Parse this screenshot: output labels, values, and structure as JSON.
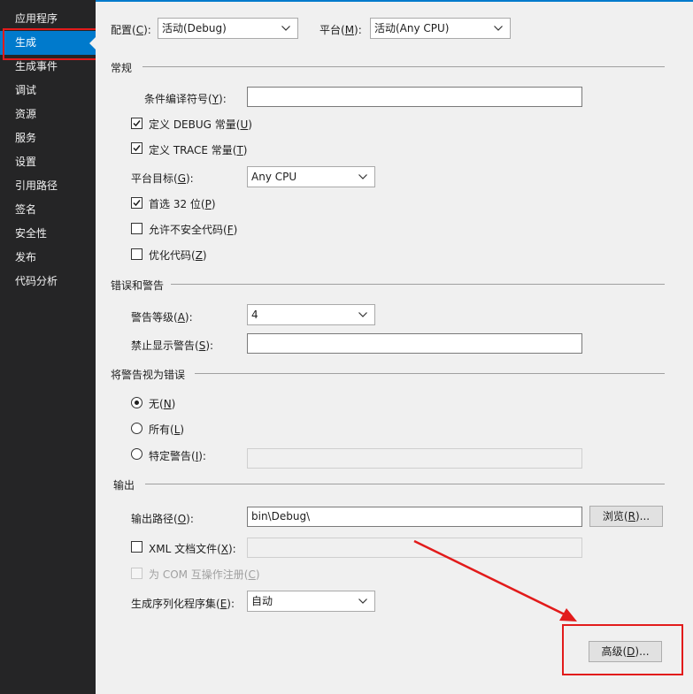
{
  "sidebar": {
    "items": [
      {
        "label": "应用程序"
      },
      {
        "label": "生成"
      },
      {
        "label": "生成事件"
      },
      {
        "label": "调试"
      },
      {
        "label": "资源"
      },
      {
        "label": "服务"
      },
      {
        "label": "设置"
      },
      {
        "label": "引用路径"
      },
      {
        "label": "签名"
      },
      {
        "label": "安全性"
      },
      {
        "label": "发布"
      },
      {
        "label": "代码分析"
      }
    ],
    "selected": "生成"
  },
  "header": {
    "config_label": "配置(",
    "config_key": "C",
    "config_suffix": "):",
    "config_value": "活动(Debug)",
    "platform_label": "平台(",
    "platform_key": "M",
    "platform_suffix": "):",
    "platform_value": "活动(Any CPU)"
  },
  "general": {
    "title": "常规",
    "cond_symbols_label": "条件编译符号(",
    "cond_symbols_key": "Y",
    "cond_symbols_suffix": "):",
    "cond_symbols_value": "",
    "define_debug": {
      "pre": "定义 DEBUG 常量(",
      "key": "U",
      "post": ")",
      "checked": true
    },
    "define_trace": {
      "pre": "定义 TRACE 常量(",
      "key": "T",
      "post": ")",
      "checked": true
    },
    "platform_target_label": "平台目标(",
    "platform_target_key": "G",
    "platform_target_suffix": "):",
    "platform_target_value": "Any CPU",
    "prefer32": {
      "pre": "首选 32 位(",
      "key": "P",
      "post": ")",
      "checked": true
    },
    "unsafe": {
      "pre": "允许不安全代码(",
      "key": "F",
      "post": ")",
      "checked": false
    },
    "optimize": {
      "pre": "优化代码(",
      "key": "Z",
      "post": ")",
      "checked": false
    }
  },
  "errors": {
    "title": "错误和警告",
    "level_label": "警告等级(",
    "level_key": "A",
    "level_suffix": "):",
    "level_value": "4",
    "suppress_label": "禁止显示警告(",
    "suppress_key": "S",
    "suppress_suffix": "):",
    "suppress_value": ""
  },
  "treat": {
    "title": "将警告视为错误",
    "none": {
      "pre": "无(",
      "key": "N",
      "post": ")",
      "selected": true
    },
    "all": {
      "pre": "所有(",
      "key": "L",
      "post": ")",
      "selected": false
    },
    "specific": {
      "pre": "特定警告(",
      "key": "I",
      "post": "):",
      "selected": false
    },
    "specific_value": ""
  },
  "output": {
    "title": "输出",
    "path_label": "输出路径(",
    "path_key": "O",
    "path_suffix": "):",
    "path_value": "bin\\Debug\\",
    "browse_pre": "浏览(",
    "browse_key": "R",
    "browse_post": ")...",
    "xml_doc": {
      "pre": "XML 文档文件(",
      "key": "X",
      "post": "):",
      "checked": false
    },
    "xml_doc_value": "",
    "com_interop": {
      "pre": "为 COM 互操作注册(",
      "key": "C",
      "post": ")",
      "checked": false
    },
    "serialization_label": "生成序列化程序集(",
    "serialization_key": "E",
    "serialization_suffix": "):",
    "serialization_value": "自动",
    "advanced_pre": "高级(",
    "advanced_key": "D",
    "advanced_post": ")..."
  },
  "colors": {
    "accent": "#007acc",
    "sidebar_bg": "#252526",
    "annotation": "#e21b1b"
  }
}
